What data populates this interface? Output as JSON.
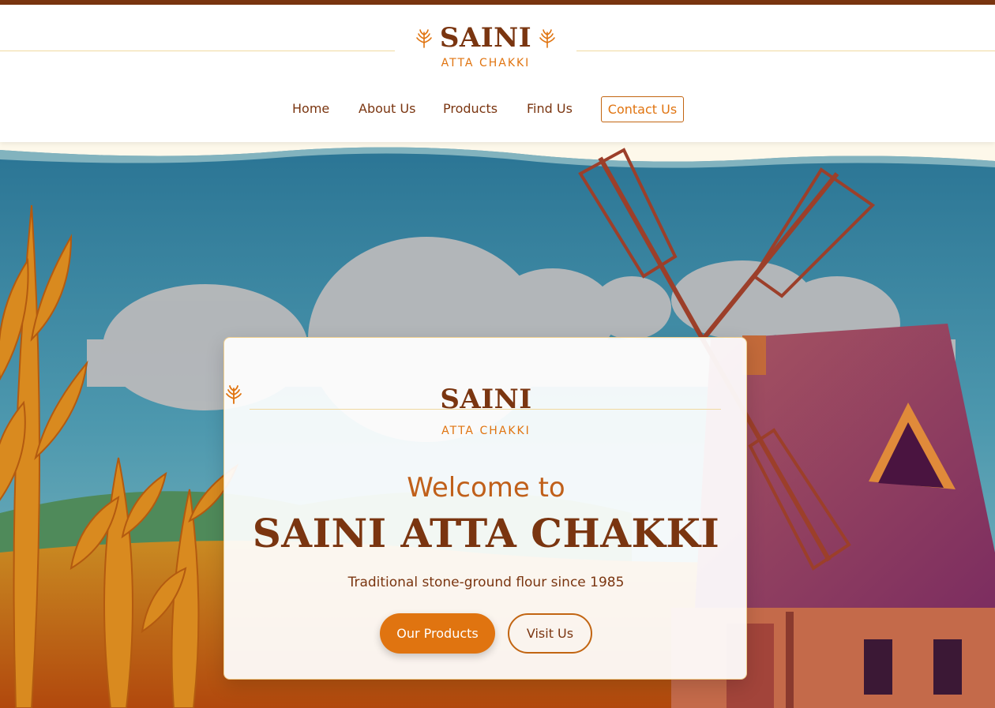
{
  "brand": {
    "name": "SAINI",
    "subtitle": "ATTA CHAKKI"
  },
  "nav": {
    "items": [
      "Home",
      "About Us",
      "Products",
      "Find Us"
    ],
    "contact": "Contact Us"
  },
  "hero": {
    "welcome": "Welcome to",
    "title": "SAINI ATTA CHAKKI",
    "tagline": "Traditional stone-ground flour since 1985",
    "primary_button": "Our Products",
    "secondary_button": "Visit Us"
  },
  "icons": [
    "wheat-icon"
  ],
  "colors": {
    "brand_brown": "#7a3510",
    "accent_orange": "#e07410",
    "gold": "#f0cf8e"
  }
}
